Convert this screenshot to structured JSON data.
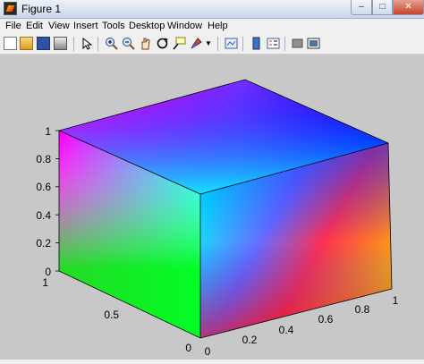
{
  "window": {
    "title": "Figure 1"
  },
  "menu": [
    "File",
    "Edit",
    "View",
    "Insert",
    "Tools",
    "Desktop",
    "Window",
    "Help"
  ],
  "toolbar_icons": [
    "new-figure-icon",
    "open-file-icon",
    "save-icon",
    "print-icon",
    "edit-plot-icon",
    "zoom-in-icon",
    "zoom-out-icon",
    "pan-icon",
    "rotate-3d-icon",
    "data-cursor-icon",
    "brush-icon",
    "link-plot-icon",
    "colorbar-icon",
    "legend-icon",
    "hide-plot-tools-icon",
    "show-plot-tools-icon"
  ],
  "axes": {
    "z_ticks": [
      "0",
      "0.2",
      "0.4",
      "0.6",
      "0.8",
      "1"
    ],
    "x_ticks": [
      "0",
      "0.2",
      "0.4",
      "0.6",
      "0.8",
      "1"
    ],
    "y_ticks": [
      "0",
      "0.5",
      "1"
    ]
  },
  "chart_data": {
    "type": "surface",
    "description_kind": "rgb-color-cube",
    "xlim": [
      0,
      1
    ],
    "ylim": [
      0,
      1
    ],
    "zlim": [
      0,
      1
    ],
    "vertex_colors": {
      "top_back": "#ff00ff",
      "top_right_back": "#0000ff",
      "top_front": "#00ffff",
      "left_bottom": "#00ff00",
      "front_bottom": "#ff0000",
      "right_bottom": "#ffc000"
    }
  }
}
